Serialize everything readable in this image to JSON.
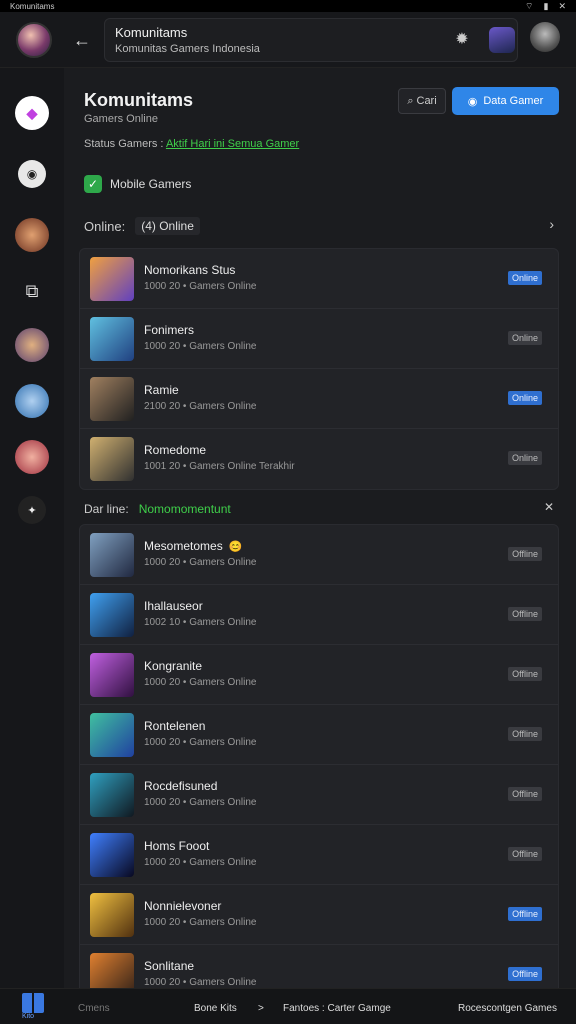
{
  "status_bar": {
    "left_text": "Komunitams",
    "wifi_icon": "wifi-icon",
    "battery_icon": "battery-icon",
    "close_icon": "close-icon"
  },
  "header": {
    "title": "Komunitams",
    "subtitle": "Komunitas Gamers Indonesia",
    "back_icon": "arrow-left-icon",
    "gear_icon": "gear-icon"
  },
  "community": {
    "title": "Komunitams",
    "subtitle": "Gamers Online",
    "search_label": "Cari",
    "primary_button": "Data Gamer",
    "filter_label": "Status Gamers :",
    "filter_value": "Aktif Hari ini Semua Gamer",
    "checkbox_label": "Mobile Gamers"
  },
  "online_section": {
    "label": "Online:",
    "count": "(4)",
    "status": "Online"
  },
  "online_list": [
    {
      "name": "Nomorikans Stus",
      "meta": "1000 20 • Gamers Online",
      "badge": "Online",
      "badge_on": true
    },
    {
      "name": "Fonimers",
      "meta": "1000 20 • Gamers Online",
      "badge": "Online",
      "badge_on": false
    },
    {
      "name": "Ramie",
      "meta": "2100 20 • Gamers Online",
      "badge": "Online",
      "badge_on": true
    },
    {
      "name": "Romedome",
      "meta": "1001 20 • Gamers Online Terakhir",
      "badge": "Online",
      "badge_on": false
    }
  ],
  "offline_section": {
    "label": "Dar line:",
    "status": "Nomomomentunt"
  },
  "offline_list": [
    {
      "name": "Mesometomes",
      "meta": "1000 20 • Gamers Online",
      "badge": "Offline",
      "badge_on": false,
      "extra": "😊"
    },
    {
      "name": "Ihallauseor",
      "meta": "1002 10 • Gamers Online",
      "badge": "Offline",
      "badge_on": false
    },
    {
      "name": "Kongranite",
      "meta": "1000 20 • Gamers Online",
      "badge": "Offline",
      "badge_on": false
    },
    {
      "name": "Rontelenen",
      "meta": "1000 20 • Gamers Online",
      "badge": "Offline",
      "badge_on": false
    },
    {
      "name": "Rocdefisuned",
      "meta": "1000 20 • Gamers Online",
      "badge": "Offline",
      "badge_on": false
    },
    {
      "name": "Homs Fooot",
      "meta": "1000 20 • Gamers Online",
      "badge": "Offline",
      "badge_on": false
    },
    {
      "name": "Nonnielevoner",
      "meta": "1000 20 • Gamers Online",
      "badge": "Offline",
      "badge_on": true
    },
    {
      "name": "Sonlitane",
      "meta": "1000 20 • Gamers Online",
      "badge": "Offline",
      "badge_on": true
    }
  ],
  "bottom_bar": {
    "logo_label": "Kito",
    "item1": "Cmens",
    "item2": "Bone Kits",
    "separator": ">",
    "item3": "Fantoes : Carter Gamge",
    "item4": "Rocescontgen Games"
  },
  "colors": {
    "accent": "#2f86e8",
    "online_badge": "#2f6fd0",
    "highlight_green": "#3fcf4a"
  }
}
